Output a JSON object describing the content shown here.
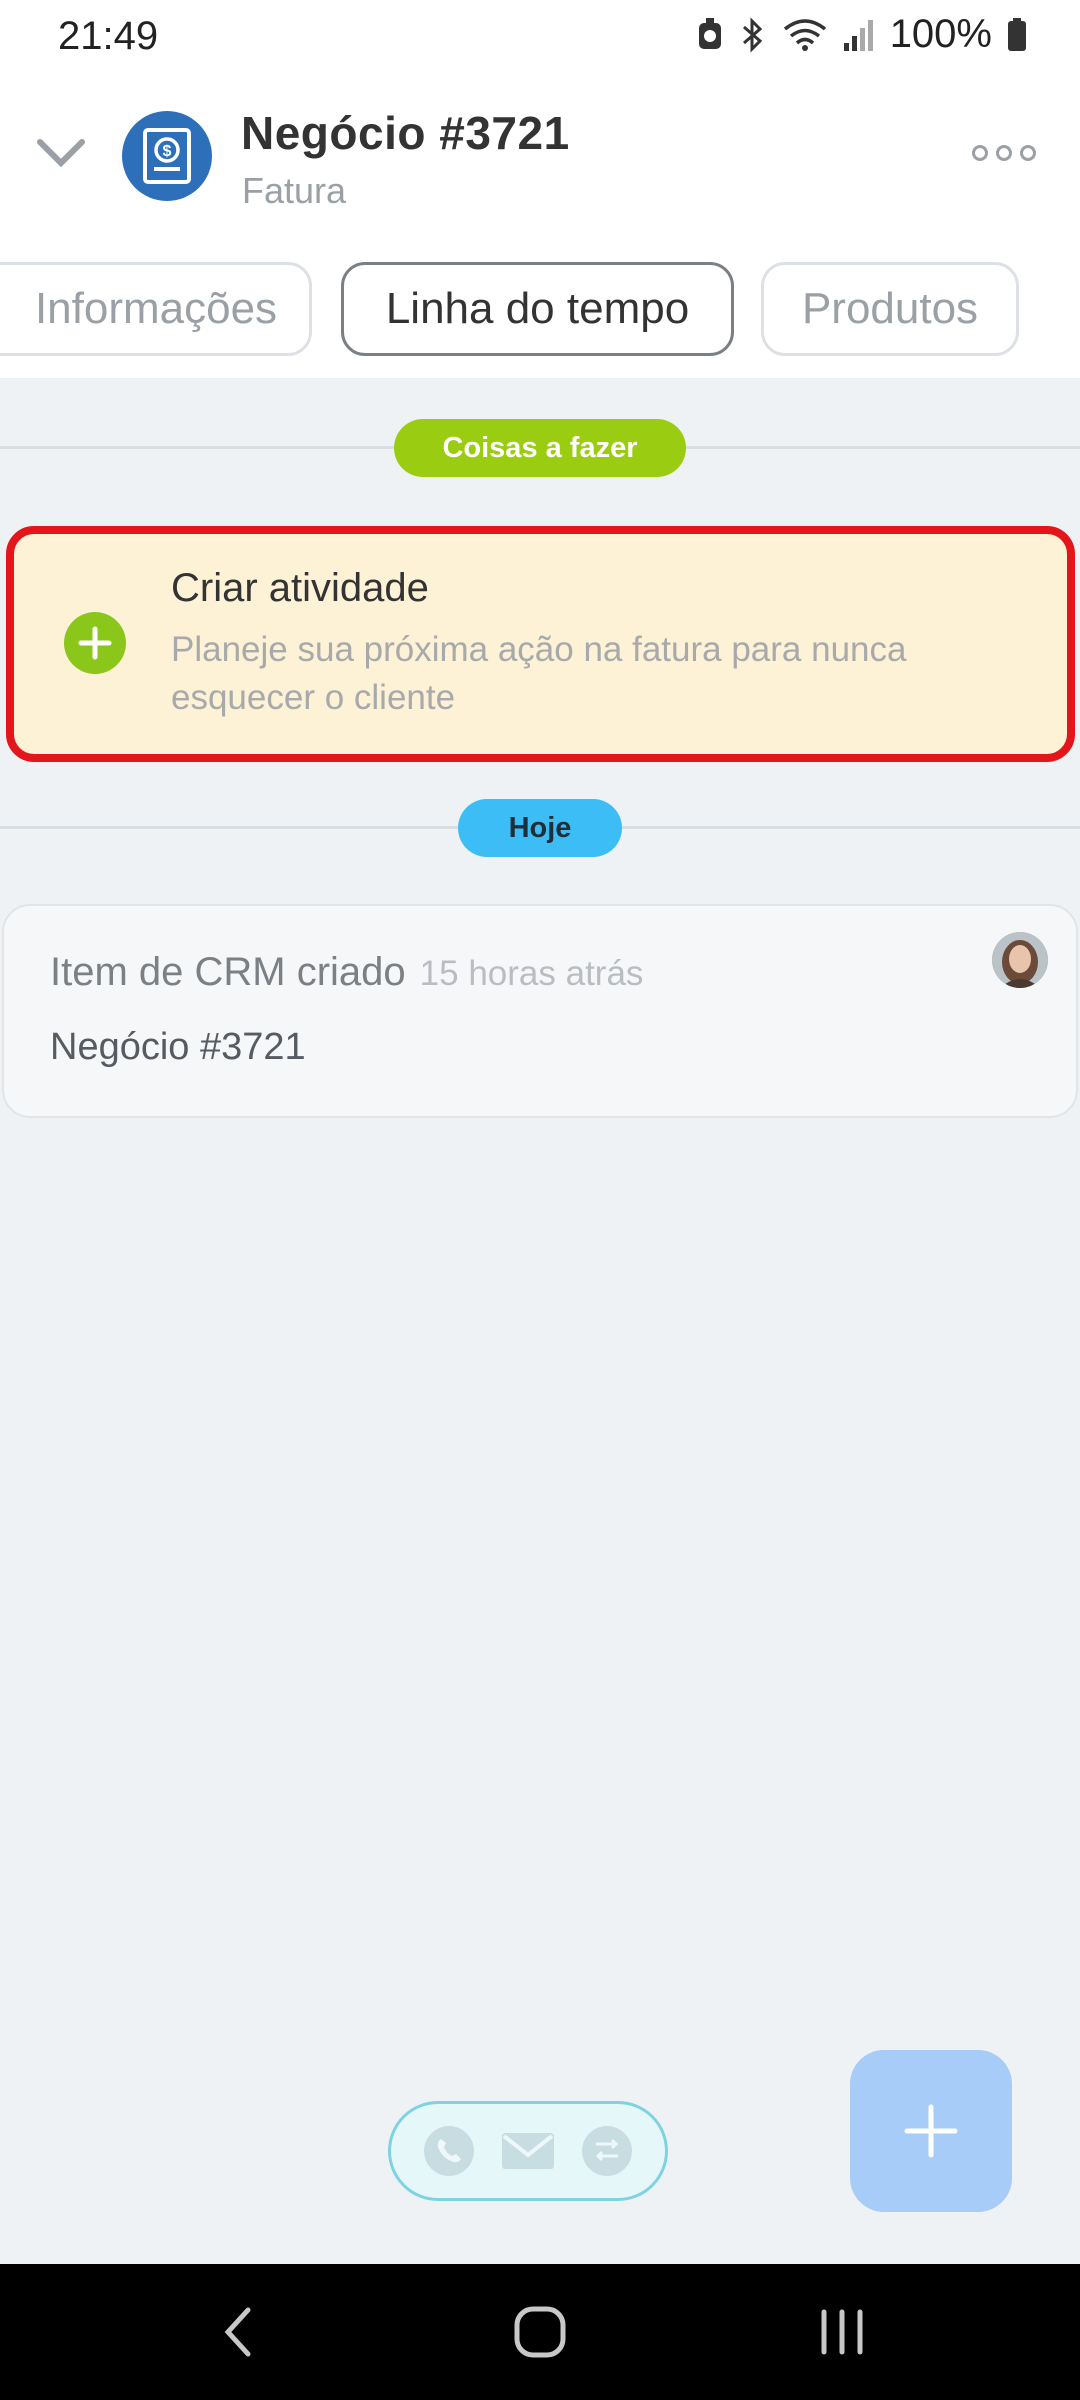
{
  "status_bar": {
    "time": "21:49",
    "battery": "100%",
    "icons": [
      "alarm-icon",
      "bluetooth-icon",
      "wifi-icon",
      "signal-icon",
      "battery-icon"
    ]
  },
  "header": {
    "title": "Negócio #3721",
    "subtitle": "Fatura",
    "avatar_icon": "invoice-dollar-icon"
  },
  "tabs": [
    {
      "label": "Informações",
      "active": false
    },
    {
      "label": "Linha do tempo",
      "active": true
    },
    {
      "label": "Produtos",
      "active": false
    }
  ],
  "timeline": {
    "todo_label": "Coisas a fazer",
    "today_label": "Hoje",
    "create_activity": {
      "title": "Criar atividade",
      "description": "Planeje sua próxima ação na fatura para nunca esquecer o cliente"
    },
    "event": {
      "title": "Item de CRM criado",
      "time": "15 horas atrás",
      "body": "Negócio #3721"
    }
  },
  "colors": {
    "accent_green": "#9acd12",
    "today_blue": "#3dbdf5",
    "highlight_red": "#e3171b",
    "card_bg": "#fdf1d6",
    "fab": "#a6ccf7"
  }
}
